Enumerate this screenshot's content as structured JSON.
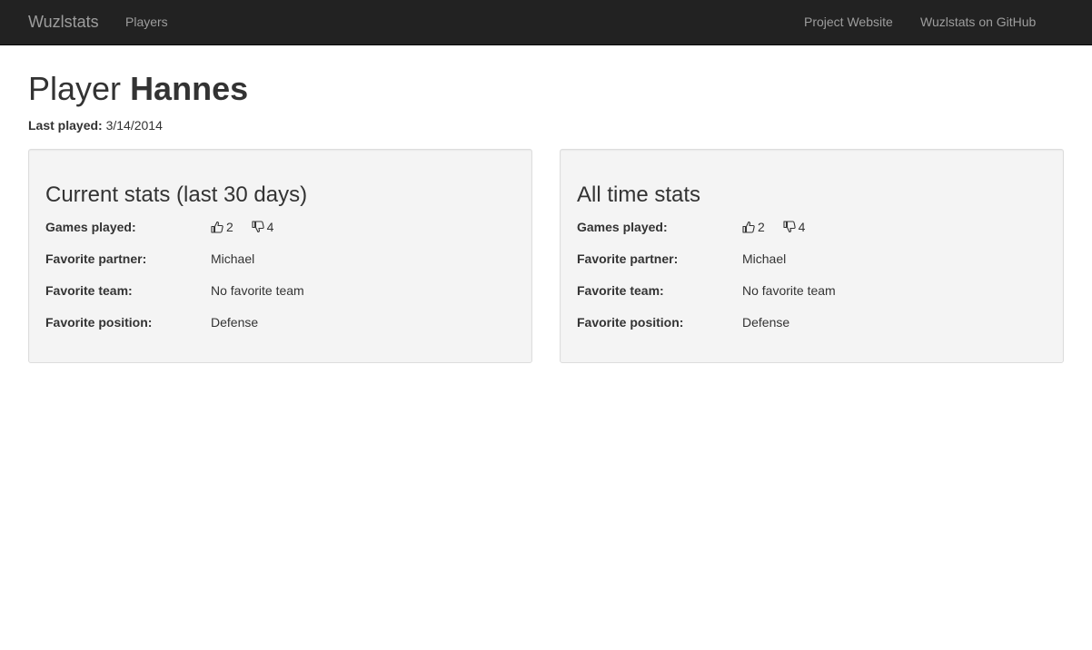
{
  "navbar": {
    "brand": "Wuzlstats",
    "links": [
      "Players"
    ],
    "right_links": [
      "Project Website",
      "Wuzlstats on GitHub"
    ]
  },
  "page": {
    "title_prefix": "Player",
    "player_name": "Hannes",
    "last_played_label": "Last played:",
    "last_played_value": "3/14/2014"
  },
  "panels": [
    {
      "heading": "Current stats (last 30 days)",
      "stats": {
        "games_label": "Games played:",
        "wins": "2",
        "losses": "4",
        "partner_label": "Favorite partner:",
        "partner_value": "Michael",
        "team_label": "Favorite team:",
        "team_value": "No favorite team",
        "position_label": "Favorite position:",
        "position_value": "Defense"
      }
    },
    {
      "heading": "All time stats",
      "stats": {
        "games_label": "Games played:",
        "wins": "2",
        "losses": "4",
        "partner_label": "Favorite partner:",
        "partner_value": "Michael",
        "team_label": "Favorite team:",
        "team_value": "No favorite team",
        "position_label": "Favorite position:",
        "position_value": "Defense"
      }
    }
  ],
  "icons": {
    "wins": "thumbs-up-icon",
    "losses": "thumbs-down-icon"
  },
  "colors": {
    "navbar_bg": "#222222",
    "nav_text": "#9d9d9d",
    "well_bg": "#f4f4f4",
    "text": "#333333"
  }
}
